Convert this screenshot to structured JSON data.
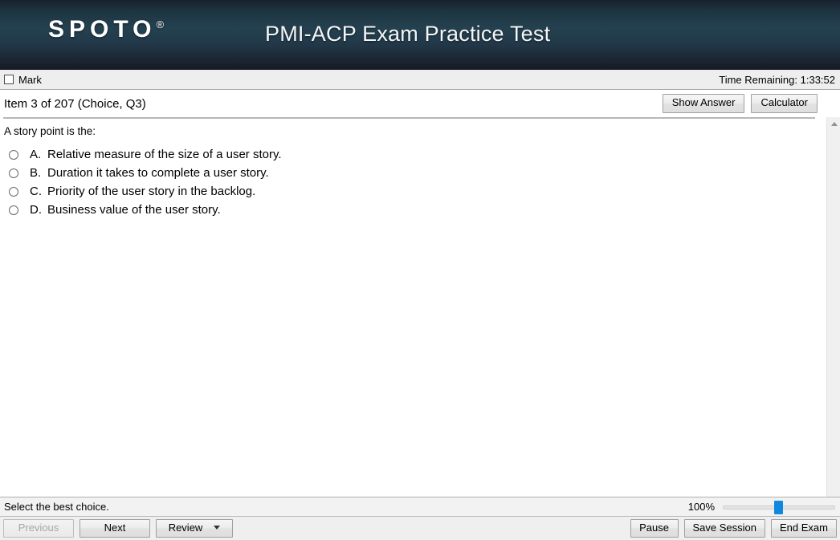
{
  "branding": {
    "logo_text": "SPOTO",
    "logo_registered_mark": "®",
    "app_title": "PMI-ACP Exam Practice Test"
  },
  "mark_bar": {
    "mark_label": "Mark",
    "mark_checked": false,
    "timer_label": "Time Remaining: 1:33:52"
  },
  "item_bar": {
    "item_label": "Item 3 of 207 (Choice, Q3)",
    "show_answer_label": "Show Answer",
    "calculator_label": "Calculator"
  },
  "question": {
    "stem": "A story point is the:",
    "choices": [
      {
        "letter": "A.",
        "text": "Relative measure of the size of a user story.",
        "selected": false
      },
      {
        "letter": "B.",
        "text": "Duration it takes to complete a user story.",
        "selected": false
      },
      {
        "letter": "C.",
        "text": "Priority of the user story in the backlog.",
        "selected": false
      },
      {
        "letter": "D.",
        "text": "Business value of the user story.",
        "selected": false
      }
    ]
  },
  "status_bar": {
    "instruction": "Select the best choice.",
    "zoom_percent": "100%"
  },
  "nav_bar": {
    "previous_label": "Previous",
    "previous_disabled": true,
    "next_label": "Next",
    "review_label": "Review",
    "pause_label": "Pause",
    "save_session_label": "Save Session",
    "end_exam_label": "End Exam"
  },
  "colors": {
    "header_gradient_top": "#18212b",
    "header_gradient_mid": "#24414f",
    "header_gradient_bottom": "#161b24",
    "slider_thumb": "#1188e0",
    "chrome_face": "#eeeeee"
  }
}
